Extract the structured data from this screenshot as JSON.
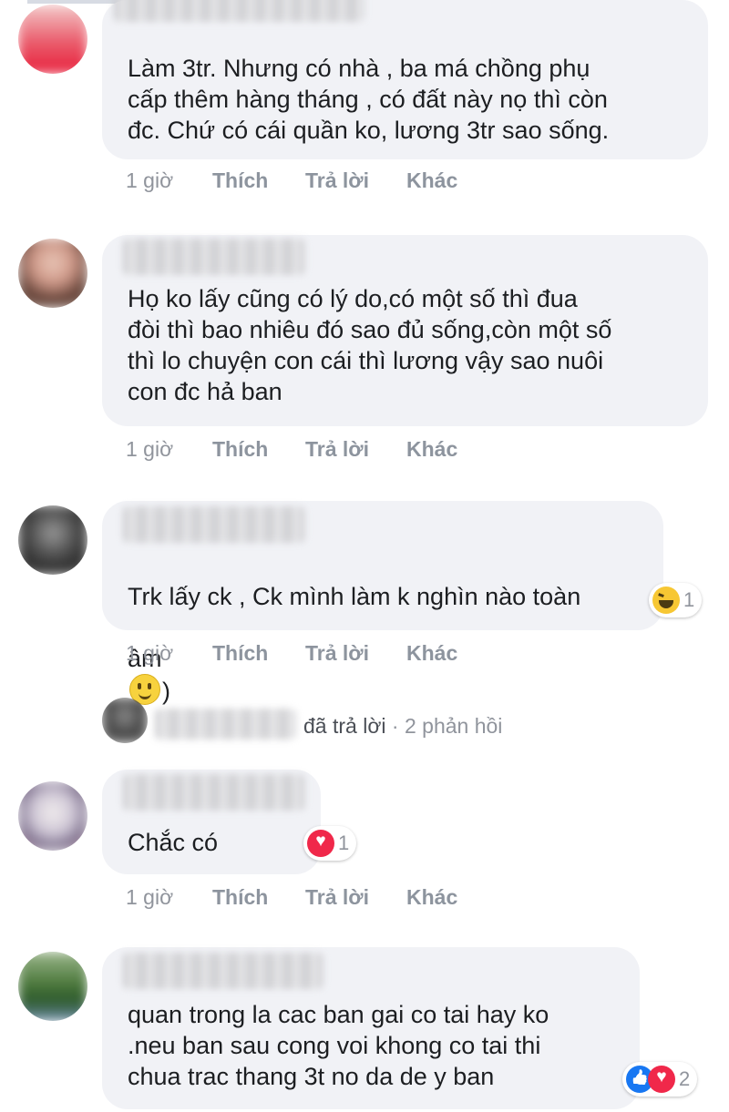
{
  "comments": [
    {
      "text": "Làm 3tr. Nhưng có nhà , ba má chồng phụ\ncấp thêm hàng tháng , có đất này nọ thì còn\nđc. Chứ có cái quần ko, lương 3tr sao sống.",
      "time": "1 giờ",
      "like": "Thích",
      "reply": "Trả lời",
      "more": "Khác"
    },
    {
      "text": "Họ ko lấy cũng có lý do,có một số thì đua\nđòi thì bao nhiêu đó sao đủ sống,còn một số\nthì lo chuyện con cái thì lương vậy sao nuôi\ncon đc hả ban",
      "time": "1 giờ",
      "like": "Thích",
      "reply": "Trả lời",
      "more": "Khác"
    },
    {
      "text_line1": "Trk lấy ck , Ck mình làm k nghìn nào toàn",
      "text_line2_pre": "âm",
      "text_line2_post": ")",
      "reaction_count": "1",
      "time": "1 giờ",
      "like": "Thích",
      "reply": "Trả lời",
      "more": "Khác",
      "replies_summary": {
        "action": "đã trả lời",
        "separator": "·",
        "count": "2 phản hồi"
      }
    },
    {
      "text": "Chắc có",
      "reaction_count": "1",
      "time": "1 giờ",
      "like": "Thích",
      "reply": "Trả lời",
      "more": "Khác"
    },
    {
      "text": "quan trong la cac ban gai co tai hay ko\n.neu ban sau cong voi khong co tai thi\nchua trac thang 3t no da de y ban",
      "reaction_count": "2"
    }
  ],
  "colors": {
    "bubble": "#f1f2f6",
    "meta": "#90949c",
    "like": "#1877f2",
    "love": "#f0284a",
    "haha": "#f7c733"
  },
  "icons": {
    "haha": "haha-reaction-icon",
    "love": "love-reaction-icon",
    "like": "like-reaction-icon",
    "smiley": "smiley-emoji-icon"
  }
}
